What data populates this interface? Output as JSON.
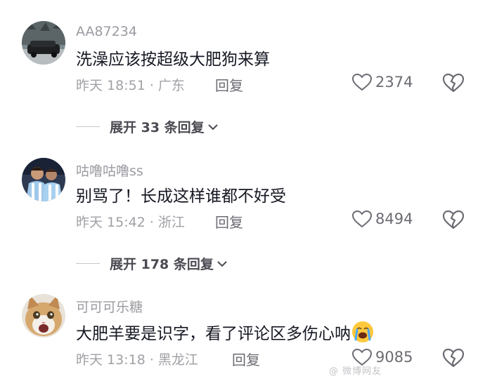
{
  "comments": [
    {
      "username": "AA87234",
      "text": "洗澡应该按超级大肥狗来算",
      "meta": "昨天 18:51 · 广东",
      "reply": "回复",
      "likes": "2374",
      "expand": "展开 33 条回复",
      "avatar": "car-photo-avatar"
    },
    {
      "username": "咕噜咕噜ss",
      "text": "别骂了！长成这样谁都不好受",
      "meta": "昨天 15:42 · 浙江",
      "reply": "回复",
      "likes": "8494",
      "expand": "展开 178 条回复",
      "avatar": "football-players-avatar"
    },
    {
      "username": "可可可乐糖",
      "text": "大肥羊要是识字，看了评论区多伤心呐",
      "meta": "昨天 13:18 · 黑龙江",
      "reply": "回复",
      "likes": "9085",
      "avatar": "cat-photo-avatar",
      "emoji": "loudly-crying-face"
    }
  ],
  "watermark": "@ 微博网友"
}
